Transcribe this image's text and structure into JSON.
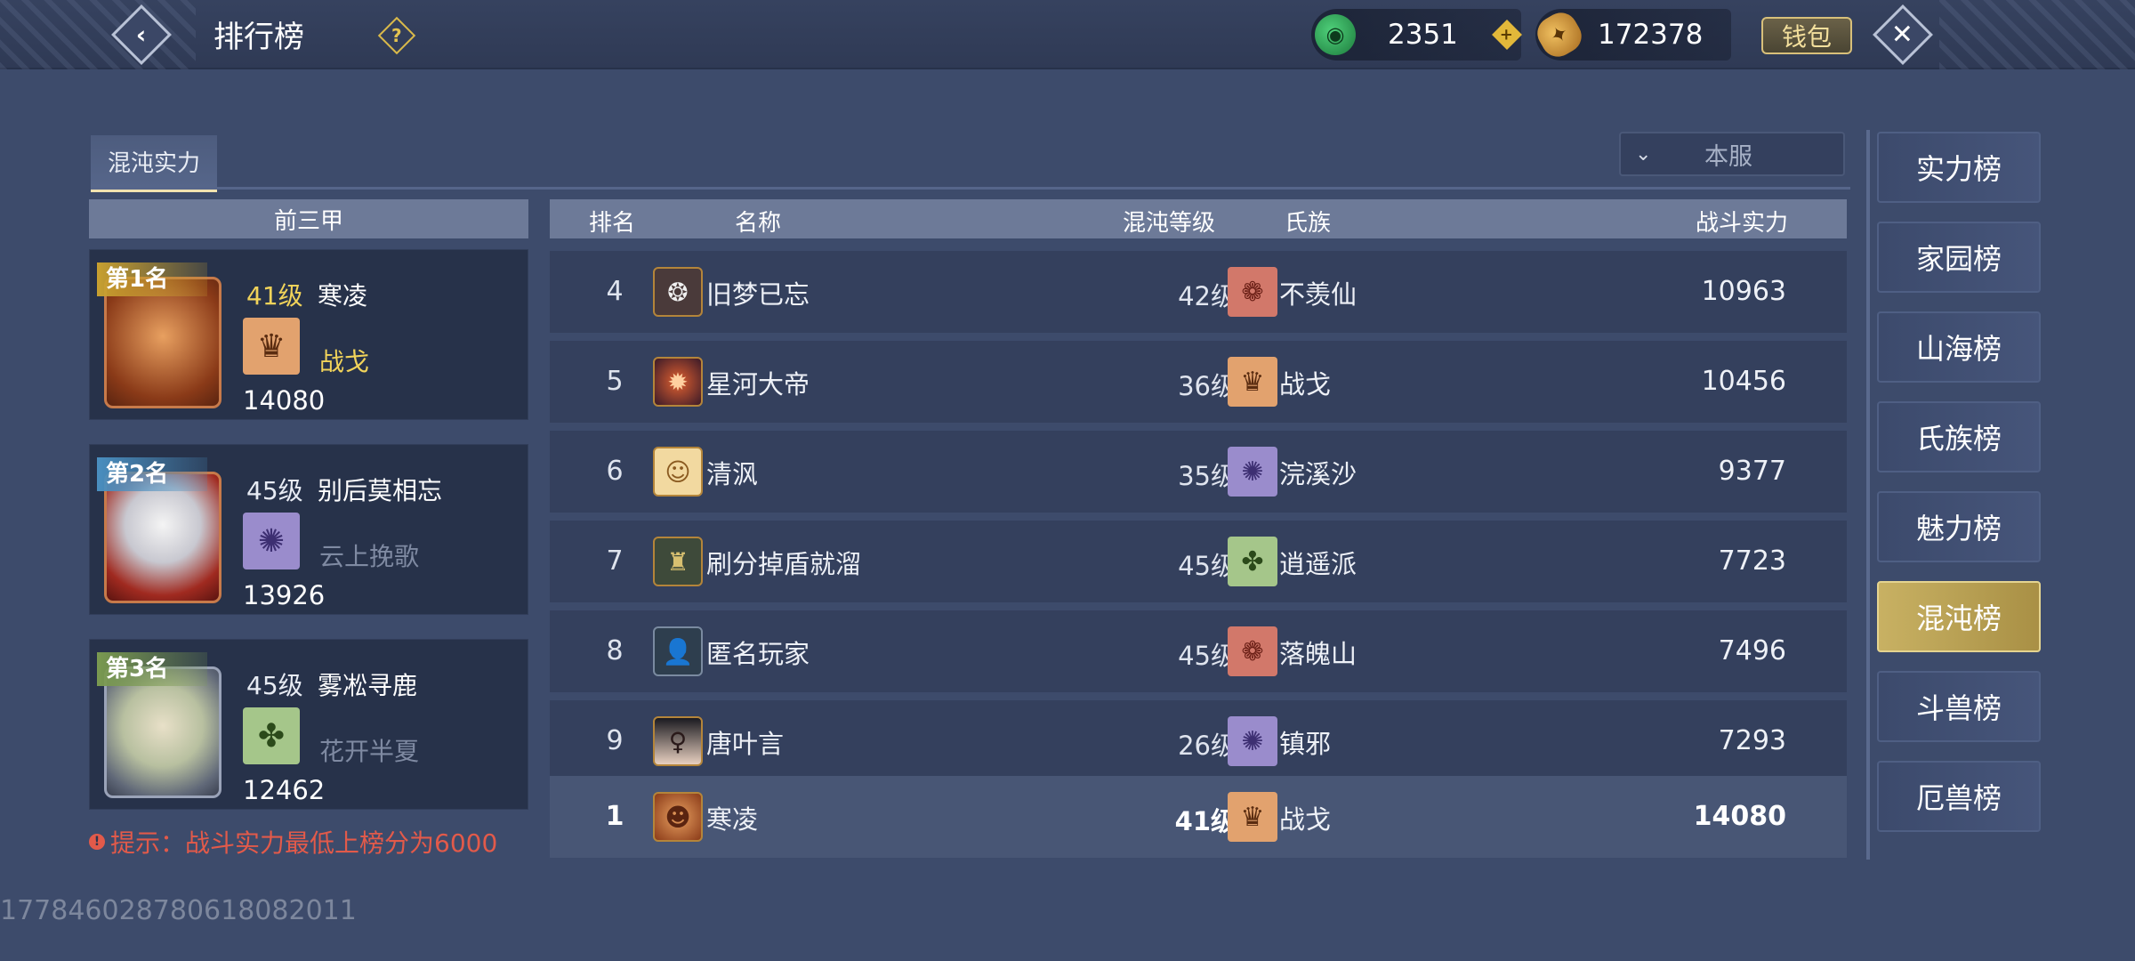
{
  "topbar": {
    "back_icon": "back-arrow-icon",
    "title": "排行榜",
    "help_icon": "?",
    "jade_amount": "2351",
    "gold_amount": "172378",
    "wallet_label": "钱包",
    "close_icon": "✕"
  },
  "tab": {
    "label": "混沌实力"
  },
  "server_select": {
    "value": "本服"
  },
  "top3": {
    "header": "前三甲",
    "cards": [
      {
        "rank_label": "第1名",
        "level": "41级",
        "name": "寒凌",
        "clan": "战戈",
        "power": "14080"
      },
      {
        "rank_label": "第2名",
        "level": "45级",
        "name": "别后莫相忘",
        "clan": "云上挽歌",
        "power": "13926"
      },
      {
        "rank_label": "第3名",
        "level": "45级",
        "name": "雾凇寻鹿",
        "clan": "花开半夏",
        "power": "12462"
      }
    ]
  },
  "hint": "提示：战斗实力最低上榜分为6000",
  "uid": "1778460287806180820​11",
  "table": {
    "headers": {
      "rank": "排名",
      "name": "名称",
      "level": "混沌等级",
      "clan": "氏族",
      "power": "战斗实力"
    },
    "rows": [
      {
        "rank": "4",
        "name": "旧梦已忘",
        "level": "42级",
        "clan": "不羡仙",
        "power": "10963"
      },
      {
        "rank": "5",
        "name": "星河大帝",
        "level": "36级",
        "clan": "战戈",
        "power": "10456"
      },
      {
        "rank": "6",
        "name": "清沨",
        "level": "35级",
        "clan": "浣溪沙",
        "power": "9377"
      },
      {
        "rank": "7",
        "name": "刷分掉盾就溜",
        "level": "45级",
        "clan": "逍遥派",
        "power": "7723"
      },
      {
        "rank": "8",
        "name": "匿名玩家",
        "level": "45级",
        "clan": "落魄山",
        "power": "7496"
      },
      {
        "rank": "9",
        "name": "唐叶言",
        "level": "26级",
        "clan": "镇邪",
        "power": "7293"
      }
    ],
    "my_row": {
      "rank": "1",
      "name": "寒凌",
      "level": "41级",
      "clan": "战戈",
      "power": "14080"
    }
  },
  "categories": [
    "实力榜",
    "家园榜",
    "山海榜",
    "氏族榜",
    "魅力榜",
    "混沌榜",
    "斗兽榜",
    "厄兽榜"
  ],
  "active_category": "混沌榜",
  "colors": {
    "accent_gold": "#f1d35a",
    "hint_red": "#e25a4a",
    "active_category": "#c8b163"
  }
}
